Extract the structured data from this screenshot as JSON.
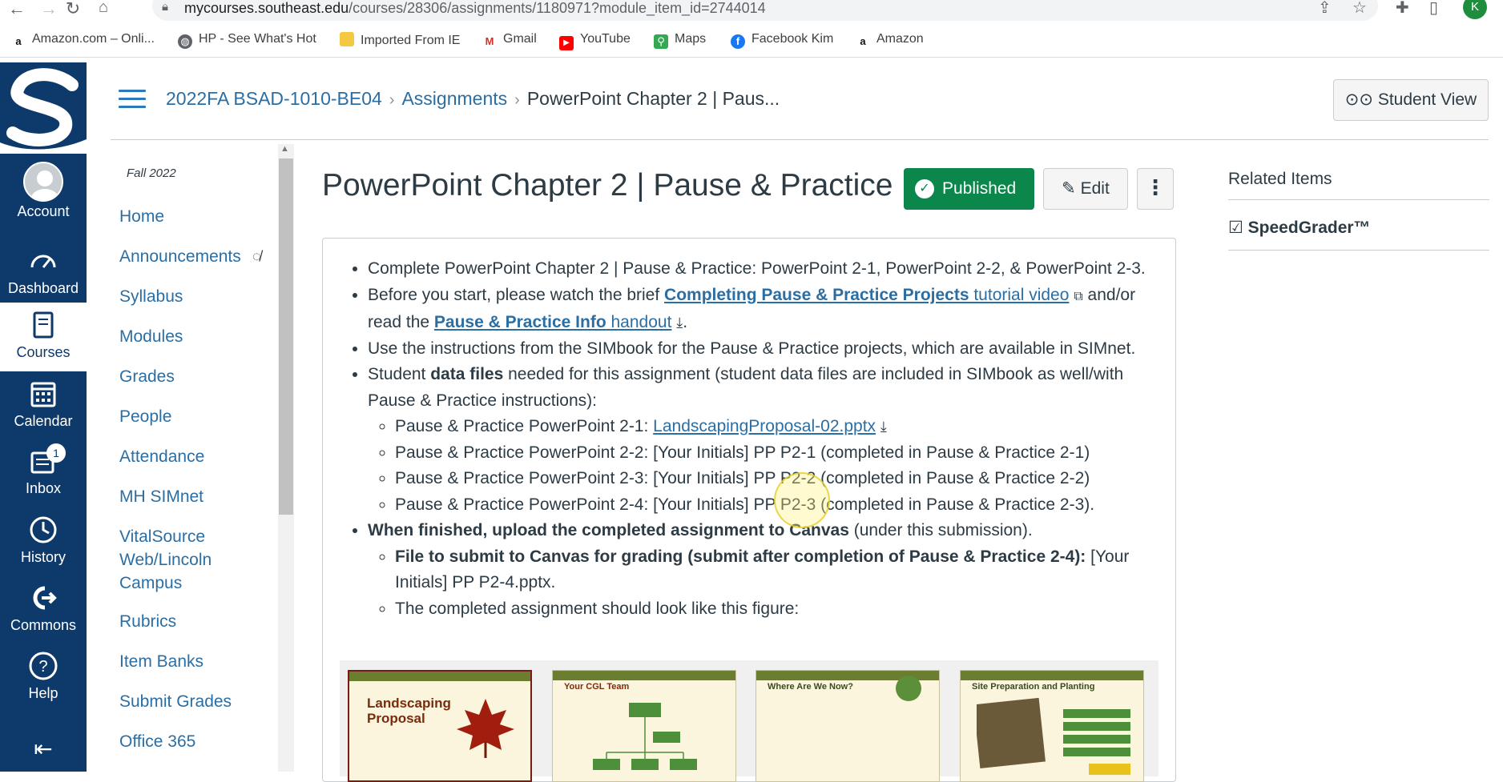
{
  "browser": {
    "url_host": "mycourses.southeast.edu",
    "url_path": "/courses/28306/assignments/1180971?module_item_id=2744014",
    "profile_initial": "K",
    "bookmarks": [
      {
        "label": "Amazon.com – Onli...",
        "icon": "amazon-icon"
      },
      {
        "label": "HP - See What's Hot",
        "icon": "globe-icon"
      },
      {
        "label": "Imported From IE",
        "icon": "folder-icon"
      },
      {
        "label": "Gmail",
        "icon": "gmail-icon"
      },
      {
        "label": "YouTube",
        "icon": "youtube-icon"
      },
      {
        "label": "Maps",
        "icon": "maps-icon"
      },
      {
        "label": "Facebook Kim",
        "icon": "facebook-icon"
      },
      {
        "label": "Amazon",
        "icon": "amazon-icon"
      }
    ]
  },
  "global_nav": {
    "items": [
      {
        "label": "Account",
        "icon": "avatar"
      },
      {
        "label": "Dashboard",
        "icon": "dashboard-icon"
      },
      {
        "label": "Courses",
        "icon": "book-icon",
        "active": true
      },
      {
        "label": "Calendar",
        "icon": "calendar-icon"
      },
      {
        "label": "Inbox",
        "icon": "inbox-icon",
        "badge": "1"
      },
      {
        "label": "History",
        "icon": "clock-icon"
      },
      {
        "label": "Commons",
        "icon": "commons-icon"
      },
      {
        "label": "Help",
        "icon": "help-icon"
      }
    ]
  },
  "header": {
    "breadcrumbs": [
      "2022FA BSAD-1010-BE04",
      "Assignments",
      "PowerPoint Chapter 2 | Paus..."
    ],
    "student_view": "Student View"
  },
  "course_nav": {
    "term": "Fall 2022",
    "items": [
      "Home",
      "Announcements",
      "Syllabus",
      "Modules",
      "Grades",
      "People",
      "Attendance",
      "MH SIMnet",
      "VitalSource Web/Lincoln Campus",
      "Rubrics",
      "Item Banks",
      "Submit Grades",
      "Office 365"
    ]
  },
  "assignment": {
    "title": "PowerPoint Chapter 2 | Pause & Practice",
    "published_label": "Published",
    "edit_label": "Edit",
    "more_label": "⋮",
    "b1": "Complete PowerPoint Chapter 2 | Pause & Practice: PowerPoint 2-1, PowerPoint 2-2, & PowerPoint 2-3.",
    "b2_pre": "Before you start, please watch the brief ",
    "b2_link1_bold": "Completing Pause & Practice Projects",
    "b2_link1_rest": " tutorial video",
    "b2_mid": " and/or read the ",
    "b2_link2_bold": "Pause & Practice Info",
    "b2_link2_rest": " handout",
    "b2_end": ".",
    "b3": "Use the instructions from the SIMbook for the Pause & Practice projects, which are available in SIMnet.",
    "b4_pre": "Student ",
    "b4_bold": "data files",
    "b4_post": " needed for this assignment (student data files are included in SIMbook as well/with Pause & Practice instructions):",
    "s1_pre": "Pause & Practice PowerPoint 2-1: ",
    "s1_link": "LandscapingProposal-02.pptx",
    "s2": "Pause & Practice PowerPoint 2-2: [Your Initials] PP P2-1 (completed in Pause & Practice 2-1)",
    "s3": "Pause & Practice PowerPoint 2-3: [Your Initials] PP P2-2 (completed in Pause & Practice 2-2)",
    "s4": "Pause & Practice PowerPoint 2-4: [Your Initials] PP P2-3 (completed in Pause & Practice 2-3).",
    "b5_bold": "When finished, upload the completed assignment to Canvas",
    "b5_post": " (under this submission).",
    "s5_bold": "File to submit to Canvas for grading (submit after completion of Pause & Practice 2-4):",
    "s5_post": " [Your Initials] PP P2-4.pptx.",
    "s6": "The completed assignment should look like this figure:",
    "slides": [
      "Landscaping Proposal",
      "Your CGL Team",
      "Where Are We Now?",
      "Site Preparation and Planting"
    ]
  },
  "related": {
    "heading": "Related Items",
    "speedgrader": "SpeedGrader™"
  }
}
